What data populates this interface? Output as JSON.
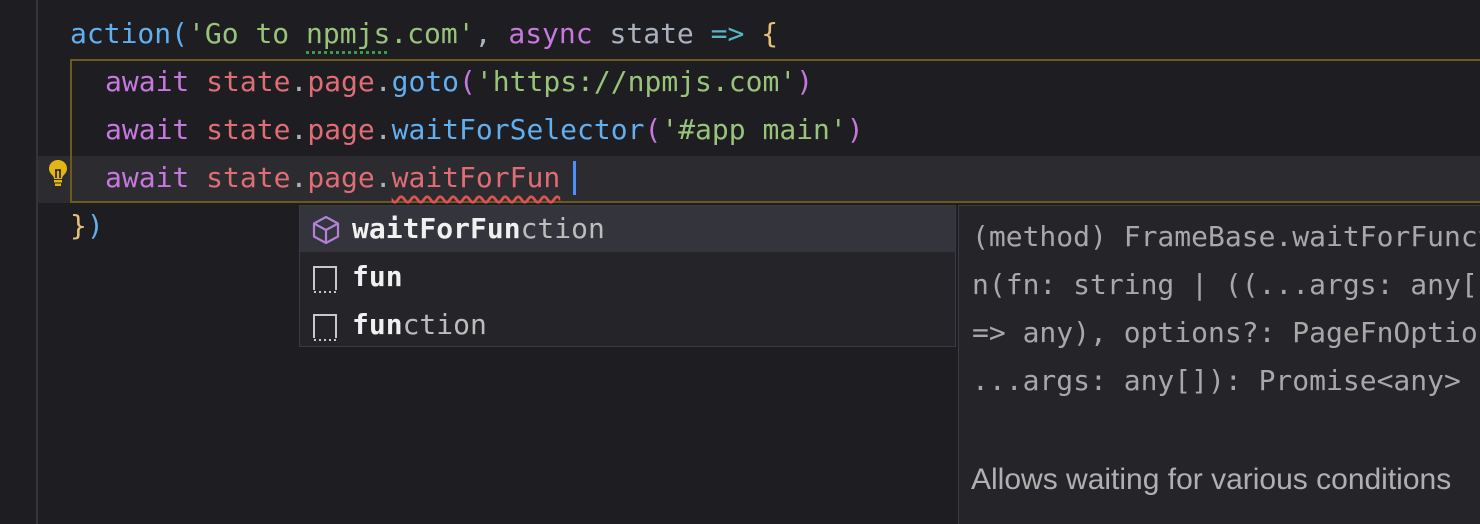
{
  "code": {
    "line1": {
      "action": "action",
      "paren_open": "(",
      "str_open": "'Go to ",
      "str_underlined": "npmjs",
      "str_close": ".com'",
      "comma": ", ",
      "async": "async",
      "space1": " ",
      "state": "state",
      "space2": " ",
      "arrow": "=>",
      "space3": " ",
      "brace_open": "{"
    },
    "line2": {
      "await": "await",
      "sp": " ",
      "state": "state",
      "dot1": ".",
      "page": "page",
      "dot2": ".",
      "method": "goto",
      "paren_open": "(",
      "string": "'https://npmjs.com'",
      "paren_close": ")"
    },
    "line3": {
      "await": "await",
      "sp": " ",
      "state": "state",
      "dot1": ".",
      "page": "page",
      "dot2": ".",
      "method": "waitForSelector",
      "paren_open": "(",
      "string": "'#app main'",
      "paren_close": ")"
    },
    "line4": {
      "await": "await",
      "sp": " ",
      "state": "state",
      "dot1": ".",
      "page": "page",
      "dot2": ".",
      "typed": "waitForFun"
    },
    "line5": {
      "brace_close": "}",
      "paren_close": ")"
    }
  },
  "suggestions": [
    {
      "match": "waitForFun",
      "rest": "ction",
      "kind_icon": "method-cube-icon",
      "selected": true
    },
    {
      "match": "fun",
      "rest": "",
      "kind_icon": "text-snippet-icon",
      "selected": false
    },
    {
      "match": "fun",
      "rest": "ction",
      "kind_icon": "text-snippet-icon",
      "selected": false
    }
  ],
  "details": {
    "signature_lines": [
      "(method) FrameBase.waitForFunctio",
      "n(fn: string | ((...args: any[])",
      "=> any), options?: PageFnOptions,",
      "...args: any[]): Promise<any>"
    ],
    "doc": "Allows waiting for various conditions"
  },
  "colors": {
    "background": "#1e1e22",
    "current_line": "#2b2b30",
    "cursor": "#4d8fff",
    "error_underline": "#e05252",
    "lightbulb": "#e2b714"
  }
}
